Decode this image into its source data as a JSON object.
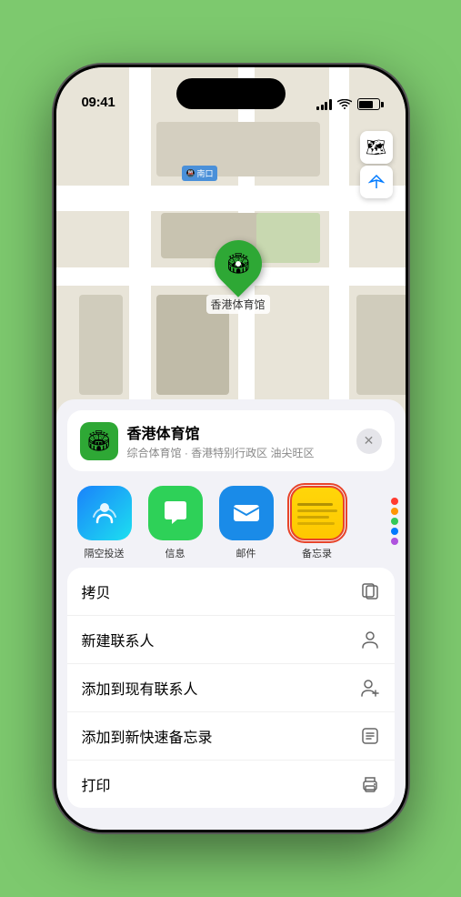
{
  "statusBar": {
    "time": "09:41",
    "locationArrow": "▶"
  },
  "mapControls": {
    "mapIcon": "🗺",
    "locationIcon": "⬆"
  },
  "locationPin": {
    "emoji": "🏟",
    "label": "香港体育馆"
  },
  "stationLabel": "南口",
  "locationCard": {
    "name": "香港体育馆",
    "desc": "综合体育馆 · 香港特别行政区 油尖旺区",
    "closeBtn": "✕"
  },
  "shareApps": [
    {
      "id": "airdrop",
      "label": "隔空投送"
    },
    {
      "id": "messages",
      "label": "信息"
    },
    {
      "id": "mail",
      "label": "邮件"
    },
    {
      "id": "notes",
      "label": "备忘录",
      "selected": true
    }
  ],
  "moreColors": [
    "#ff3b30",
    "#ff9500",
    "#34c759",
    "#007aff",
    "#af52de"
  ],
  "actionItems": [
    {
      "label": "拷贝",
      "icon": "copy"
    },
    {
      "label": "新建联系人",
      "icon": "person"
    },
    {
      "label": "添加到现有联系人",
      "icon": "person-add"
    },
    {
      "label": "添加到新快速备忘录",
      "icon": "note"
    },
    {
      "label": "打印",
      "icon": "printer"
    }
  ]
}
